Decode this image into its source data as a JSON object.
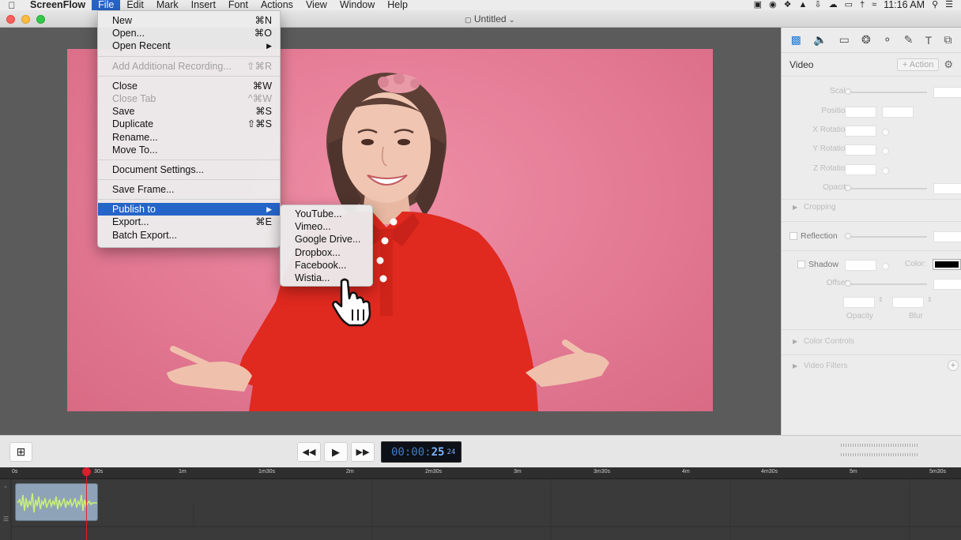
{
  "menubar": {
    "app": "ScreenFlow",
    "items": [
      "File",
      "Edit",
      "Mark",
      "Insert",
      "Font",
      "Actions",
      "View",
      "Window",
      "Help"
    ],
    "active": "File",
    "clock": "11:16 AM"
  },
  "window": {
    "title": "Untitled"
  },
  "file_menu": {
    "items": [
      {
        "label": "New",
        "shortcut": "⌘N"
      },
      {
        "label": "Open...",
        "shortcut": "⌘O"
      },
      {
        "label": "Open Recent",
        "submenu": true
      },
      {
        "sep": true
      },
      {
        "label": "Add Additional Recording...",
        "shortcut": "⇧⌘R",
        "disabled": true
      },
      {
        "sep": true
      },
      {
        "label": "Close",
        "shortcut": "⌘W"
      },
      {
        "label": "Close Tab",
        "shortcut": "^⌘W",
        "disabled": true
      },
      {
        "label": "Save",
        "shortcut": "⌘S"
      },
      {
        "label": "Duplicate",
        "shortcut": "⇧⌘S"
      },
      {
        "label": "Rename..."
      },
      {
        "label": "Move To..."
      },
      {
        "sep": true
      },
      {
        "label": "Document Settings..."
      },
      {
        "sep": true
      },
      {
        "label": "Save Frame..."
      },
      {
        "sep": true
      },
      {
        "label": "Publish to",
        "submenu": true,
        "selected": true
      },
      {
        "label": "Export...",
        "shortcut": "⌘E"
      },
      {
        "label": "Batch Export..."
      }
    ]
  },
  "publish_submenu": {
    "items": [
      "YouTube...",
      "Vimeo...",
      "Google Drive...",
      "Dropbox...",
      "Facebook...",
      "Wistia..."
    ]
  },
  "inspector": {
    "section": "Video",
    "action_label": "+ Action",
    "labels": {
      "scale": "Scale",
      "position": "Position",
      "x_rotation": "X Rotation",
      "y_rotation": "Y Rotation",
      "z_rotation": "Z Rotation",
      "opacity": "Opacity",
      "cropping": "Cropping",
      "reflection": "Reflection",
      "shadow": "Shadow",
      "color": "Color:",
      "offset": "Offset:",
      "opacity2": "Opacity",
      "blur": "Blur",
      "color_controls": "Color Controls",
      "video_filters": "Video Filters"
    }
  },
  "transport": {
    "timecode_main": "00:00:",
    "timecode_sec": "25",
    "timecode_frames": "24"
  },
  "timeline": {
    "ticks": [
      "0s",
      "30s",
      "1m",
      "1m30s",
      "2m",
      "2m30s",
      "3m",
      "3m30s",
      "4m",
      "4m30s",
      "5m",
      "5m30s"
    ],
    "playhead_seconds": 24
  },
  "colors": {
    "accent": "#2565c8",
    "playhead": "#d8202c",
    "background_pink": "#e57c96",
    "shirt_red": "#e0291f"
  }
}
